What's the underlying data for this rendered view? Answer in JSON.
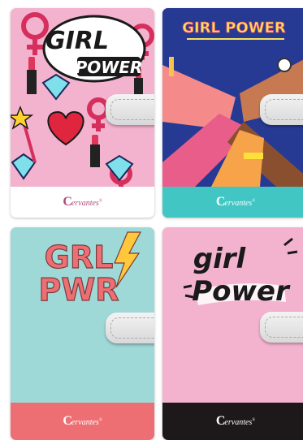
{
  "notebooks": [
    {
      "cover_text": [
        "GIRL",
        "POWER"
      ],
      "brand": "ervantes",
      "trademark": "®"
    },
    {
      "cover_text": "GIRL POWER",
      "brand": "ervantes",
      "trademark": "®"
    },
    {
      "cover_text": [
        "GRL",
        "PWR"
      ],
      "brand": "ervantes",
      "trademark": "®"
    },
    {
      "cover_text": [
        "girl",
        "Power"
      ],
      "brand": "ervantes",
      "trademark": "®"
    }
  ],
  "colors": {
    "pink": "#f3b3cf",
    "teal": "#41c6c4",
    "mint": "#9fd9d7",
    "coral": "#ee6f73",
    "black": "#1d1819",
    "navy": "#263a93"
  }
}
